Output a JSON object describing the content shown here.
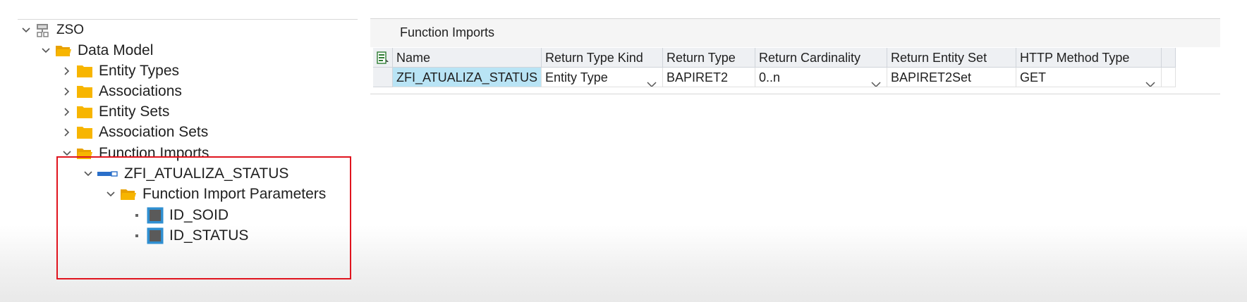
{
  "tree": {
    "root": {
      "label": "ZSO",
      "icon": "service-icon"
    },
    "data_model": {
      "label": "Data Model",
      "icon": "folder-open-icon"
    },
    "children": [
      {
        "label": "Entity Types",
        "icon": "folder-icon"
      },
      {
        "label": "Associations",
        "icon": "folder-icon"
      },
      {
        "label": "Entity Sets",
        "icon": "folder-icon"
      },
      {
        "label": "Association Sets",
        "icon": "folder-icon"
      }
    ],
    "function_imports": {
      "label": "Function Imports",
      "icon": "folder-open-icon"
    },
    "function_import_item": {
      "label": "ZFI_ATUALIZA_STATUS",
      "icon": "function-import-icon"
    },
    "parameters_folder": {
      "label": "Function Import Parameters",
      "icon": "folder-open-icon"
    },
    "parameters": [
      {
        "label": "ID_SOID",
        "icon": "parameter-icon"
      },
      {
        "label": "ID_STATUS",
        "icon": "parameter-icon"
      }
    ],
    "highlight_color": "#e0141e"
  },
  "panel": {
    "title": "Function Imports",
    "columns": [
      "Name",
      "Return Type Kind",
      "Return Type",
      "Return Cardinality",
      "Return Entity Set",
      "HTTP Method Type"
    ],
    "rows": [
      {
        "name": "ZFI_ATUALIZA_STATUS",
        "return_type_kind": "Entity Type",
        "return_type": "BAPIRET2",
        "return_cardinality": "0..n",
        "return_entity_set": "BAPIRET2Set",
        "http_method_type": "GET"
      }
    ],
    "selected_cell_color": "#b9e4f5"
  }
}
